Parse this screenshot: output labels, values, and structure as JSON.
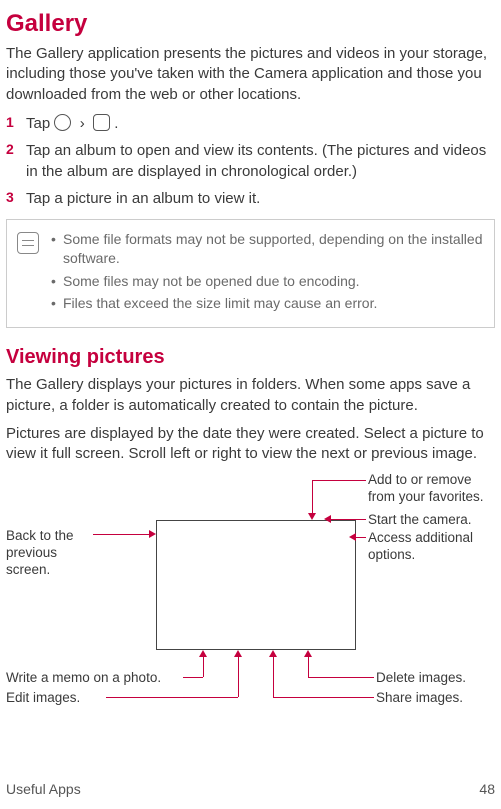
{
  "title": "Gallery",
  "intro": "The Gallery application presents the pictures and videos in your storage, including those you've taken with the Camera application and those you downloaded from the web or other locations.",
  "steps": [
    {
      "num": "1",
      "prefix": "Tap ",
      "suffix": "."
    },
    {
      "num": "2",
      "text": "Tap an album to open and view its contents. (The pictures and videos in the album are displayed in chronological order.)"
    },
    {
      "num": "3",
      "text": "Tap a picture in an album to view it."
    }
  ],
  "notes": [
    "Some file formats may not be supported, depending on the installed software.",
    "Some files may not be opened due to encoding.",
    "Files that exceed the size limit may cause an error."
  ],
  "section2_title": "Viewing pictures",
  "section2_p1": "The Gallery displays your pictures in folders. When some apps save a picture, a folder is automatically created to contain the picture.",
  "section2_p2": "Pictures are displayed by the date they were created. Select a picture to view it full screen. Scroll left or right to view the next or previous image.",
  "callouts": {
    "back": "Back to the previous screen.",
    "memo": "Write a memo on a photo.",
    "edit": "Edit images.",
    "fav": "Add to or remove from your favorites.",
    "camera": "Start the camera.",
    "options": "Access additional options.",
    "delete": "Delete images.",
    "share": "Share images."
  },
  "footer_section": "Useful Apps",
  "page_number": "48"
}
